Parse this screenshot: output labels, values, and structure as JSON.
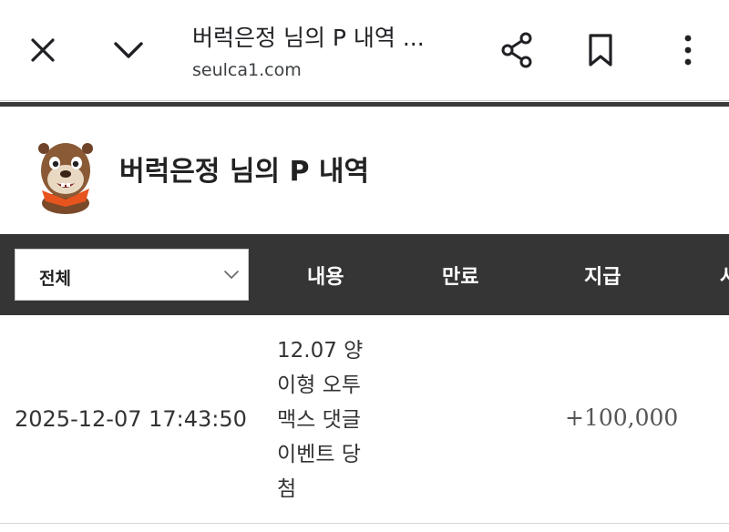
{
  "browser": {
    "title": "버럭은정 님의 P 내역 ...",
    "url": "seulca1.com",
    "icons": [
      "close-icon",
      "chevron-down-icon",
      "share-icon",
      "bookmark-icon",
      "more-vert-icon"
    ]
  },
  "page": {
    "title": "버럭은정 님의 P 내역",
    "avatar": "otter-mascot"
  },
  "table": {
    "filter_selected": "전체",
    "columns": [
      "내용",
      "만료",
      "지급",
      "사"
    ],
    "rows": [
      {
        "datetime": "2025-12-07 17:43:50",
        "content_lines": [
          "12.07 양",
          "이형 오투",
          "맥스 댓글",
          "이벤트 당",
          "첨"
        ],
        "expire": "",
        "amount": "+100,000"
      }
    ]
  },
  "colors": {
    "header_bg": "#353535",
    "accent_line": "#3b3b3b",
    "text": "#222222"
  }
}
